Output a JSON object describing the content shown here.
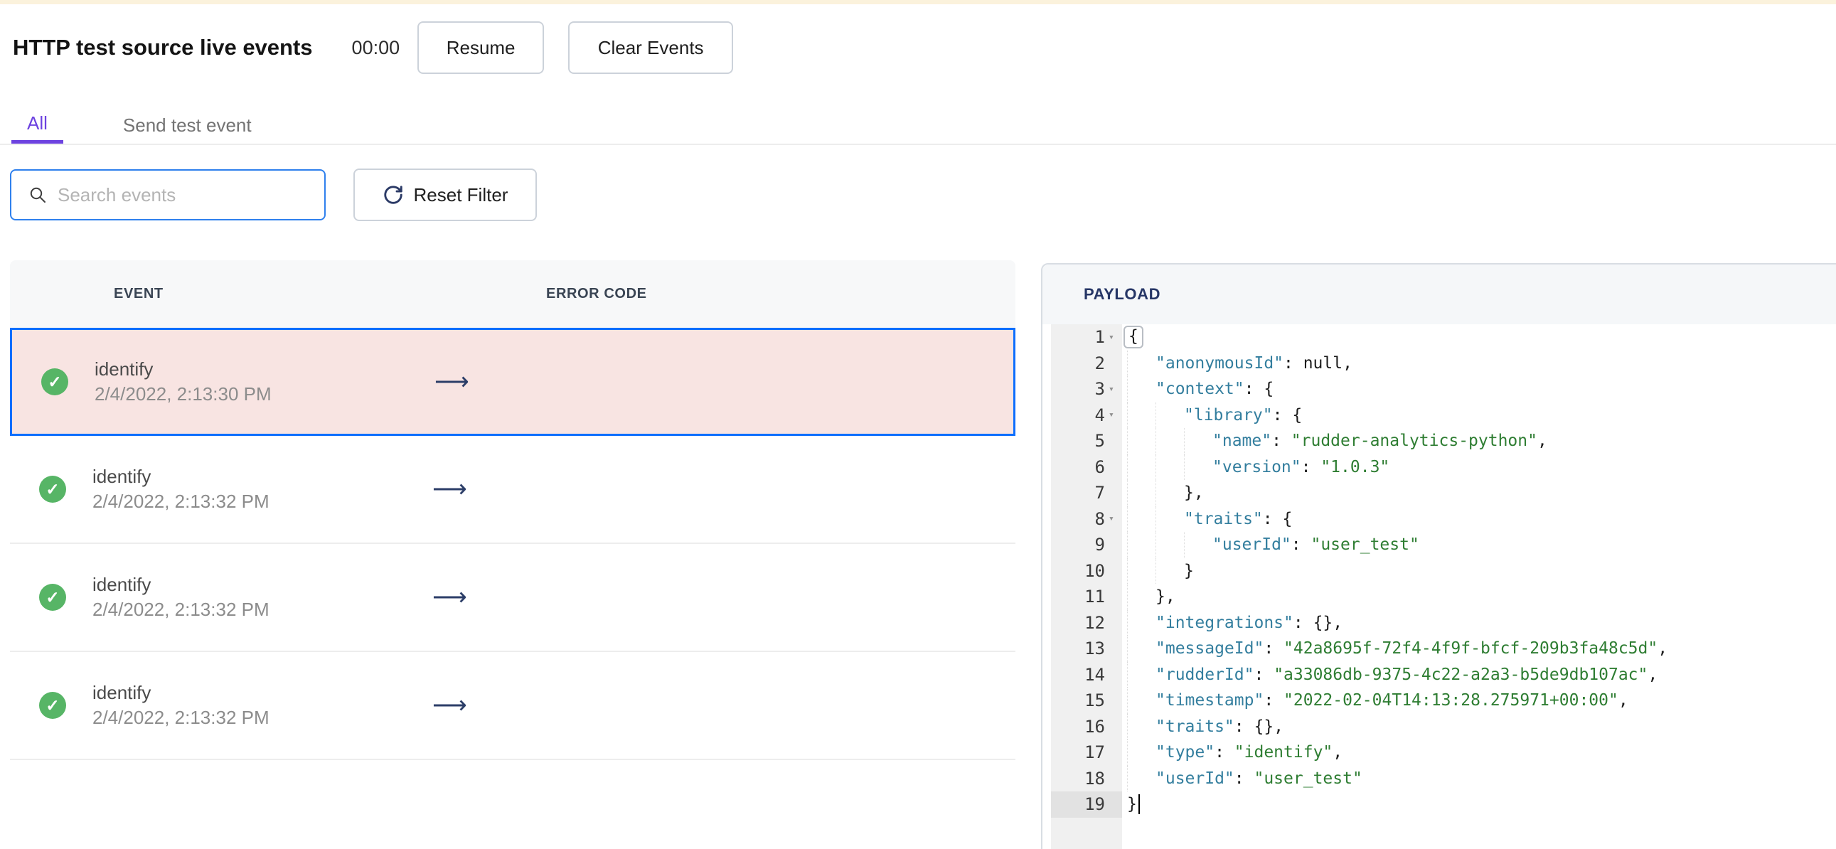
{
  "page": {
    "title": "HTTP test source live events",
    "timer": "00:00",
    "resume_label": "Resume",
    "clear_label": "Clear Events"
  },
  "tabs": {
    "all": "All",
    "send": "Send test event"
  },
  "filters": {
    "search_placeholder": "Search events",
    "reset_label": "Reset Filter"
  },
  "events_table": {
    "columns": {
      "event": "EVENT",
      "error_code": "ERROR CODE"
    },
    "status_glyph": "✓",
    "arrow_glyph": "⟶",
    "rows": [
      {
        "name": "identify",
        "time": "2/4/2022, 2:13:30 PM",
        "status": "success",
        "selected": true
      },
      {
        "name": "identify",
        "time": "2/4/2022, 2:13:32 PM",
        "status": "success",
        "selected": false
      },
      {
        "name": "identify",
        "time": "2/4/2022, 2:13:32 PM",
        "status": "success",
        "selected": false
      },
      {
        "name": "identify",
        "time": "2/4/2022, 2:13:32 PM",
        "status": "success",
        "selected": false
      }
    ]
  },
  "payload_panel": {
    "title": "PAYLOAD",
    "fold_glyph": "▾",
    "code_lines": [
      {
        "n": 1,
        "fold": true,
        "ind": 0,
        "seg": [
          [
            "box",
            "{"
          ]
        ]
      },
      {
        "n": 2,
        "fold": false,
        "ind": 1,
        "seg": [
          [
            "key",
            "\"anonymousId\""
          ],
          [
            "pln",
            ": null,"
          ]
        ]
      },
      {
        "n": 3,
        "fold": true,
        "ind": 1,
        "seg": [
          [
            "key",
            "\"context\""
          ],
          [
            "pln",
            ": {"
          ]
        ]
      },
      {
        "n": 4,
        "fold": true,
        "ind": 2,
        "seg": [
          [
            "key",
            "\"library\""
          ],
          [
            "pln",
            ": {"
          ]
        ]
      },
      {
        "n": 5,
        "fold": false,
        "ind": 3,
        "seg": [
          [
            "key",
            "\"name\""
          ],
          [
            "pln",
            ": "
          ],
          [
            "str",
            "\"rudder-analytics-python\""
          ],
          [
            "pln",
            ","
          ]
        ]
      },
      {
        "n": 6,
        "fold": false,
        "ind": 3,
        "seg": [
          [
            "key",
            "\"version\""
          ],
          [
            "pln",
            ": "
          ],
          [
            "str",
            "\"1.0.3\""
          ]
        ]
      },
      {
        "n": 7,
        "fold": false,
        "ind": 2,
        "seg": [
          [
            "pln",
            "},"
          ]
        ]
      },
      {
        "n": 8,
        "fold": true,
        "ind": 2,
        "seg": [
          [
            "key",
            "\"traits\""
          ],
          [
            "pln",
            ": {"
          ]
        ]
      },
      {
        "n": 9,
        "fold": false,
        "ind": 3,
        "seg": [
          [
            "key",
            "\"userId\""
          ],
          [
            "pln",
            ": "
          ],
          [
            "str",
            "\"user_test\""
          ]
        ]
      },
      {
        "n": 10,
        "fold": false,
        "ind": 2,
        "seg": [
          [
            "pln",
            "}"
          ]
        ]
      },
      {
        "n": 11,
        "fold": false,
        "ind": 1,
        "seg": [
          [
            "pln",
            "},"
          ]
        ]
      },
      {
        "n": 12,
        "fold": false,
        "ind": 1,
        "seg": [
          [
            "key",
            "\"integrations\""
          ],
          [
            "pln",
            ": {},"
          ]
        ]
      },
      {
        "n": 13,
        "fold": false,
        "ind": 1,
        "seg": [
          [
            "key",
            "\"messageId\""
          ],
          [
            "pln",
            ": "
          ],
          [
            "str",
            "\"42a8695f-72f4-4f9f-bfcf-209b3fa48c5d\""
          ],
          [
            "pln",
            ","
          ]
        ]
      },
      {
        "n": 14,
        "fold": false,
        "ind": 1,
        "seg": [
          [
            "key",
            "\"rudderId\""
          ],
          [
            "pln",
            ": "
          ],
          [
            "str",
            "\"a33086db-9375-4c22-a2a3-b5de9db107ac\""
          ],
          [
            "pln",
            ","
          ]
        ]
      },
      {
        "n": 15,
        "fold": false,
        "ind": 1,
        "seg": [
          [
            "key",
            "\"timestamp\""
          ],
          [
            "pln",
            ": "
          ],
          [
            "str",
            "\"2022-02-04T14:13:28.275971+00:00\""
          ],
          [
            "pln",
            ","
          ]
        ]
      },
      {
        "n": 16,
        "fold": false,
        "ind": 1,
        "seg": [
          [
            "key",
            "\"traits\""
          ],
          [
            "pln",
            ": {},"
          ]
        ]
      },
      {
        "n": 17,
        "fold": false,
        "ind": 1,
        "seg": [
          [
            "key",
            "\"type\""
          ],
          [
            "pln",
            ": "
          ],
          [
            "str",
            "\"identify\""
          ],
          [
            "pln",
            ","
          ]
        ]
      },
      {
        "n": 18,
        "fold": false,
        "ind": 1,
        "seg": [
          [
            "key",
            "\"userId\""
          ],
          [
            "pln",
            ": "
          ],
          [
            "str",
            "\"user_test\""
          ]
        ]
      },
      {
        "n": 19,
        "fold": false,
        "ind": 0,
        "active": true,
        "cursor": true,
        "seg": [
          [
            "pln",
            "}"
          ]
        ]
      }
    ]
  },
  "colors": {
    "accent_purple": "#6d43e0",
    "selected_row_border": "#0d6efd",
    "selected_row_bg": "#f8e4e2",
    "success_green": "#57b566",
    "focus_blue": "#2f80ed",
    "code_key_teal": "#337e9e",
    "code_string_green": "#2e7d32",
    "top_strip_cream": "#fbf2dc"
  }
}
